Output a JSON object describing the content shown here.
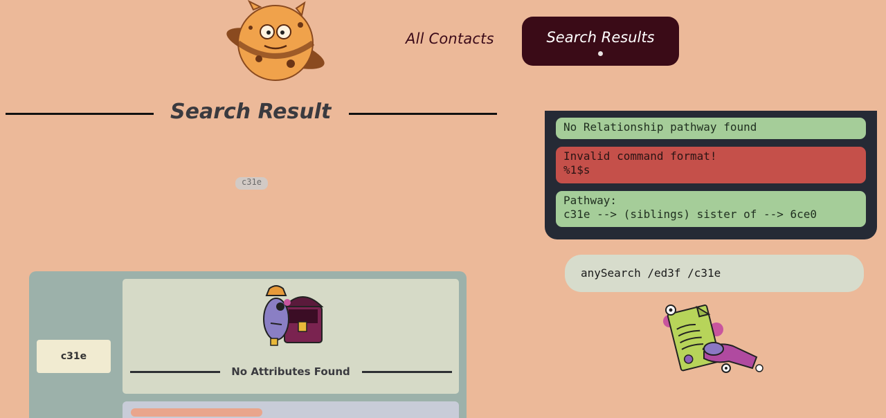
{
  "nav": {
    "all_contacts": "All Contacts",
    "search_results": "Search Results"
  },
  "heading": {
    "title": "Search Result"
  },
  "graph": {
    "node_chip": "c31e"
  },
  "console": {
    "messages": [
      {
        "type": "success",
        "line1": "No Relationship pathway found",
        "line2": ""
      },
      {
        "type": "error",
        "line1": "Invalid command format!",
        "line2": "%1$s"
      },
      {
        "type": "success",
        "line1": "Pathway:",
        "line2": "c31e -->  (siblings) sister of  --> 6ce0"
      }
    ]
  },
  "command_box": {
    "value": "anySearch /ed3f /c31e"
  },
  "results_panel": {
    "node_label": "c31e",
    "attributes_empty": "No Attributes Found"
  },
  "colors": {
    "background": "#ecb999",
    "nav_active_bg": "#3a0b17",
    "console_bg": "#252a35",
    "success": "#a5cd99",
    "error": "#c5504a",
    "panel": "#9cb1aa"
  },
  "icons": {
    "logo": "planet-cookie-mascot-icon",
    "empty_state": "pirate-treasure-chest-icon",
    "command_illustration": "signing-document-icon"
  }
}
